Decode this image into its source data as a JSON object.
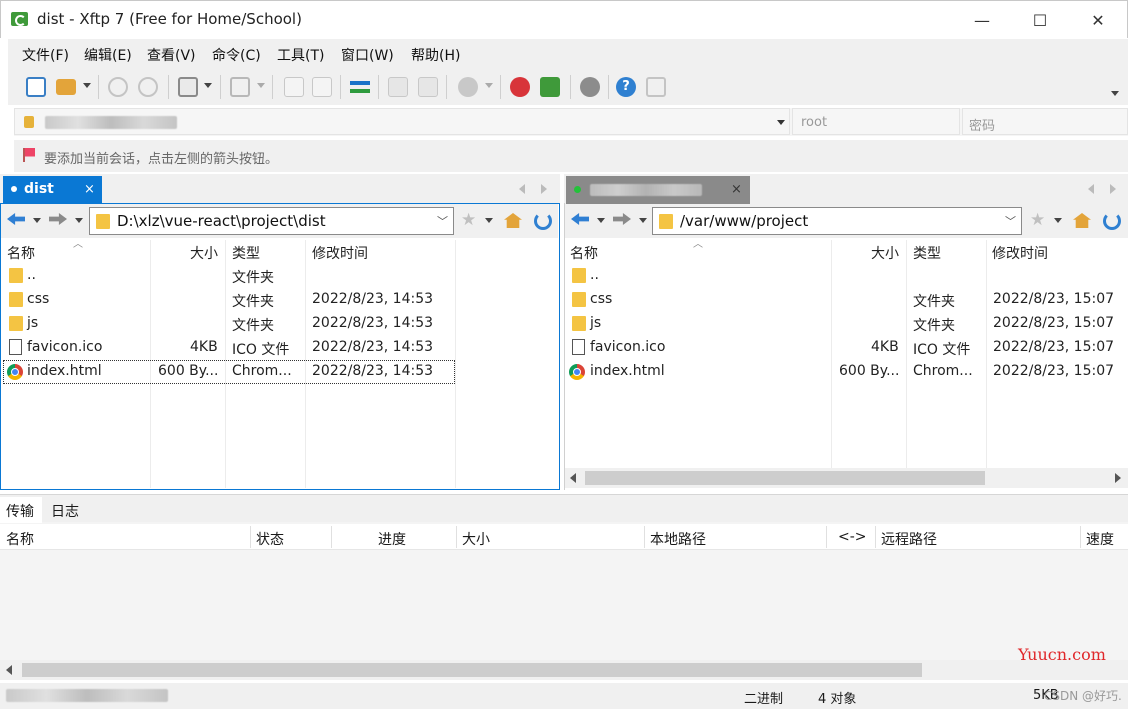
{
  "window": {
    "title": "dist - Xftp 7 (Free for Home/School)",
    "minimize": "—",
    "maximize": "☐",
    "close": "✕"
  },
  "menu": [
    "文件(F)",
    "编辑(E)",
    "查看(V)",
    "命令(C)",
    "工具(T)",
    "窗口(W)",
    "帮助(H)"
  ],
  "address": {
    "user_placeholder": "root",
    "password_placeholder": "密码"
  },
  "hint": "要添加当前会话，点击左侧的箭头按钮。",
  "local": {
    "tab_label": "dist",
    "tab_close": "×",
    "path": "D:\\xlz\\vue-react\\project\\dist",
    "columns": {
      "name": "名称",
      "size": "大小",
      "type": "类型",
      "modified": "修改时间"
    },
    "files": [
      {
        "name": "..",
        "size": "",
        "type": "文件夹",
        "modified": "",
        "icon": "folder-icon"
      },
      {
        "name": "css",
        "size": "",
        "type": "文件夹",
        "modified": "2022/8/23, 14:53",
        "icon": "folder-icon"
      },
      {
        "name": "js",
        "size": "",
        "type": "文件夹",
        "modified": "2022/8/23, 14:53",
        "icon": "folder-icon"
      },
      {
        "name": "favicon.ico",
        "size": "4KB",
        "type": "ICO 文件",
        "modified": "2022/8/23, 14:53",
        "icon": "ico-file-icon"
      },
      {
        "name": "index.html",
        "size": "600 By...",
        "type": "Chrom...",
        "modified": "2022/8/23, 14:53",
        "icon": "chrome-icon"
      }
    ]
  },
  "remote": {
    "tab_close": "×",
    "path": "/var/www/project",
    "columns": {
      "name": "名称",
      "size": "大小",
      "type": "类型",
      "modified": "修改时间"
    },
    "files": [
      {
        "name": "..",
        "size": "",
        "type": "",
        "modified": "",
        "icon": "folder-icon"
      },
      {
        "name": "css",
        "size": "",
        "type": "文件夹",
        "modified": "2022/8/23, 15:07",
        "icon": "folder-icon"
      },
      {
        "name": "js",
        "size": "",
        "type": "文件夹",
        "modified": "2022/8/23, 15:07",
        "icon": "folder-icon"
      },
      {
        "name": "favicon.ico",
        "size": "4KB",
        "type": "ICO 文件",
        "modified": "2022/8/23, 15:07",
        "icon": "ico-file-icon"
      },
      {
        "name": "index.html",
        "size": "600 By...",
        "type": "Chrom...",
        "modified": "2022/8/23, 15:07",
        "icon": "chrome-icon"
      }
    ]
  },
  "transfer": {
    "tabs": [
      "传输",
      "日志"
    ],
    "columns": [
      "名称",
      "状态",
      "进度",
      "大小",
      "本地路径",
      "<->",
      "远程路径",
      "速度"
    ]
  },
  "status": {
    "mode": "二进制",
    "count": "4 对象",
    "size": "5KB"
  },
  "watermark": {
    "site": "Yuucn.com",
    "author": "CSDN @好巧."
  },
  "colors": {
    "accent": "#0078d7",
    "local_tab": "#0a78d4",
    "remote_tab": "#8a8a8a"
  }
}
